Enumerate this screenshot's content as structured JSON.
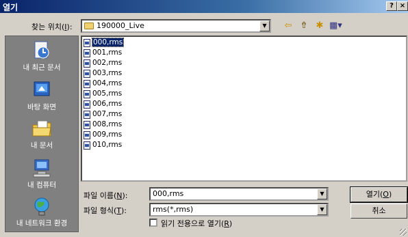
{
  "window": {
    "title": "열기",
    "help_label": "?",
    "close_label": "×"
  },
  "lookin": {
    "label_pre": "찾는 위치(",
    "label_key": "I",
    "label_post": "):",
    "value": "190000_Live"
  },
  "toolbar": {
    "back_icon": "back-arrow-icon",
    "up_icon": "up-folder-icon",
    "newfolder_icon": "new-folder-icon",
    "views_icon": "views-menu-icon"
  },
  "places": [
    {
      "label": "내 최근 문서",
      "icon": "recent-documents-icon"
    },
    {
      "label": "바탕 화면",
      "icon": "desktop-icon"
    },
    {
      "label": "내 문서",
      "icon": "my-documents-icon"
    },
    {
      "label": "내 컴퓨터",
      "icon": "my-computer-icon"
    },
    {
      "label": "내 네트워크 환경",
      "icon": "network-places-icon"
    }
  ],
  "files": [
    "000,rms",
    "001,rms",
    "002,rms",
    "003,rms",
    "004,rms",
    "005,rms",
    "006,rms",
    "007,rms",
    "008,rms",
    "009,rms",
    "010,rms"
  ],
  "selected_file": "000,rms",
  "filename": {
    "label_pre": "파일 이름(",
    "label_key": "N",
    "label_post": "):",
    "value": "000,rms"
  },
  "filetype": {
    "label_pre": "파일 형식(",
    "label_key": "T",
    "label_post": "):",
    "value": "rms(*,rms)"
  },
  "readonly": {
    "label_pre": "읽기 전용으로 열기(",
    "label_key": "R",
    "label_post": ")",
    "checked": false
  },
  "buttons": {
    "open_pre": "열기(",
    "open_key": "O",
    "open_post": ")",
    "cancel": "취소"
  },
  "colors": {
    "title_bar": "#0a246a",
    "places_bg": "#808080",
    "dialog_bg": "#d4d0c8",
    "selection": "#0a246a"
  }
}
